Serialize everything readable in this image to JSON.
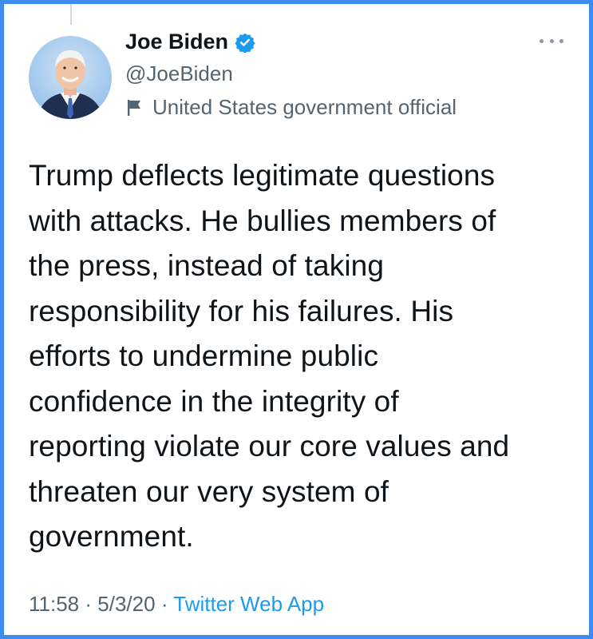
{
  "user": {
    "display_name": "Joe Biden",
    "handle": "@JoeBiden",
    "label": "United States government official",
    "verified_color": "#1d9bf0"
  },
  "tweet": {
    "lines": [
      "Trump deflects legitimate questions",
      "with attacks. He bullies members of",
      "the press, instead of taking",
      "responsibility for his failures. His",
      "efforts to undermine public",
      "confidence in the integrity of",
      "reporting violate our core values and",
      "threaten our very system of",
      "government."
    ]
  },
  "meta": {
    "time": "11:58",
    "separator": "·",
    "date": "5/3/20",
    "source": "Twitter Web App"
  },
  "colors": {
    "frame_border": "#3d8cf0",
    "link": "#1d9bf0",
    "secondary_text": "#536471"
  }
}
